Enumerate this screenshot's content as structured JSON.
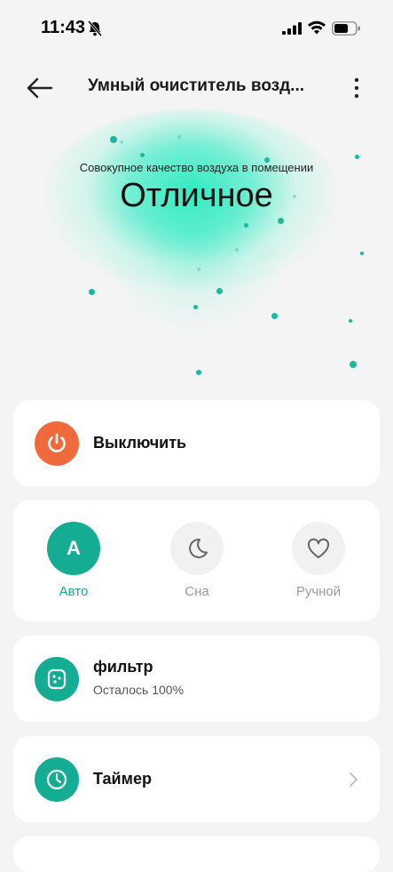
{
  "status_bar": {
    "time": "11:43"
  },
  "header": {
    "title": "Умный очиститель возд..."
  },
  "hero": {
    "subtitle": "Совокупное качество воздуха в помещении",
    "quality": "Отличное"
  },
  "power": {
    "label": "Выключить",
    "color": "#f06a3b"
  },
  "modes": [
    {
      "label": "Авто",
      "icon_letter": "A",
      "active": true
    },
    {
      "label": "Сна",
      "icon": "moon-icon",
      "active": false
    },
    {
      "label": "Ручной",
      "icon": "heart-icon",
      "active": false
    }
  ],
  "filter": {
    "label": "фильтр",
    "remaining": "Осталось 100%"
  },
  "timer": {
    "label": "Таймер"
  },
  "colors": {
    "accent": "#14ad94",
    "background": "#f4f4f4",
    "card": "#ffffff"
  }
}
